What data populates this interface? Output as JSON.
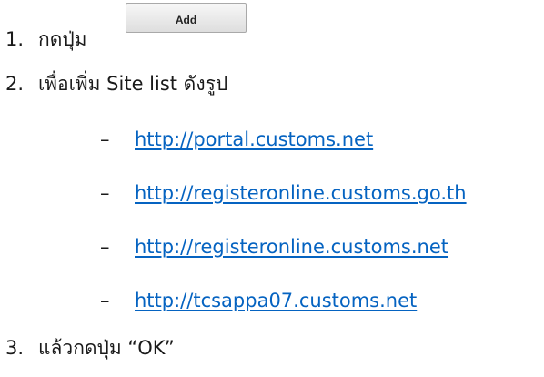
{
  "steps": [
    {
      "number": "1.",
      "text": "กดปุ่ม"
    },
    {
      "number": "2.",
      "text": "เพื่อเพิ่ม Site list ดังรูป"
    },
    {
      "number": "3.",
      "text": "แล้วกดปุ่ม “OK”"
    }
  ],
  "add_button": {
    "label": "Add"
  },
  "site_list": {
    "bullet": "–",
    "items": [
      "http://portal.customs.net",
      "http://registeronline.customs.go.th",
      "http://registeronline.customs.net",
      "http://tcsappa07.customs.net"
    ]
  },
  "colors": {
    "link": "#0563c1",
    "text": "#1a1a1a",
    "button_border": "#a9a9a9"
  }
}
